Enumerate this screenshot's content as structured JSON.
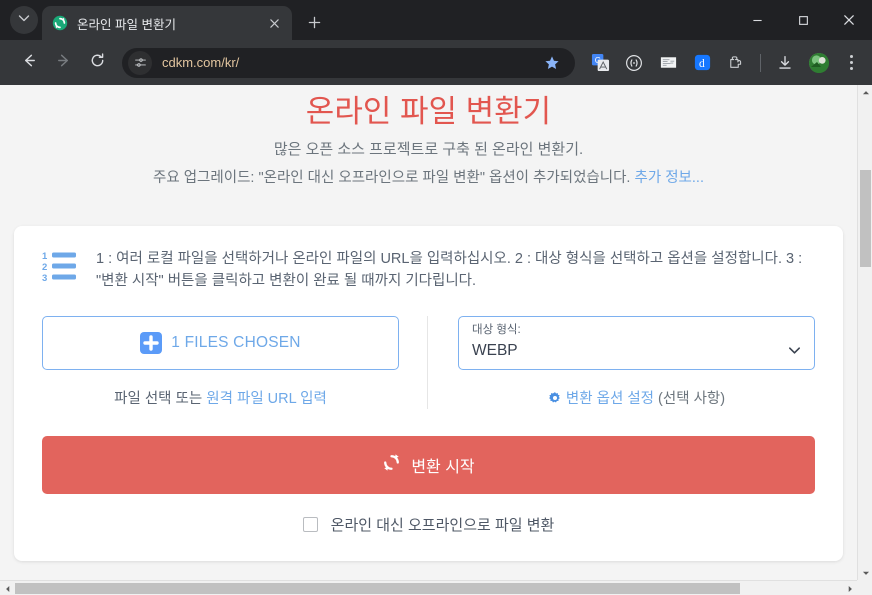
{
  "browser": {
    "tab": {
      "title": "온라인 파일 변환기",
      "favicon_name": "sync-green-favicon",
      "close_label": "✕",
      "new_tab_label": "+"
    },
    "tab_list_icon": "chevron-down-icon",
    "nav": {
      "back": "back-arrow-icon",
      "forward": "forward-arrow-icon",
      "reload": "reload-icon"
    },
    "omnibox": {
      "site_settings_icon": "tune-sliders-icon",
      "url": "cdkm.com/kr/",
      "bookmark_icon": "star-filled-icon"
    },
    "extensions": [
      {
        "name": "google-translate-icon",
        "label": "G"
      },
      {
        "name": "bracket-circle-icon",
        "label": "()"
      },
      {
        "name": "reading-list-icon",
        "label": ""
      },
      {
        "name": "d-extension-icon",
        "label": "d"
      },
      {
        "name": "puzzle-extensions-icon",
        "label": ""
      }
    ],
    "download_icon": "download-icon",
    "avatar_name": "profile-avatar",
    "menu_icon": "three-dot-menu-icon",
    "window_controls": {
      "minimize": "minimize-icon",
      "maximize": "maximize-icon",
      "close": "close-icon"
    }
  },
  "page": {
    "title": "온라인 파일 변환기",
    "subtitle": "많은 오픈 소스 프로젝트로 구축 된 온라인 변환기.",
    "notice_text": "주요 업그레이드: \"온라인 대신 오프라인으로 파일 변환\" 옵션이 추가되었습니다. ",
    "notice_link": "추가 정보...",
    "howto_icon": "numbered-list-icon",
    "howto": "1 : 여러 로컬 파일을 선택하거나 온라인 파일의 URL을 입력하십시오. 2 : 대상 형식을 선택하고 옵션을 설정합니다. 3 : \"변환 시작\" 버튼을 클릭하고 변환이 완료 될 때까지 기다립니다.",
    "file_chooser": {
      "plus_icon": "plus-square-icon",
      "label": "1 FILES CHOSEN",
      "hint_prefix": "파일 선택 또는 ",
      "hint_link": "원격 파일 URL 입력"
    },
    "target_format": {
      "label": "대상 형식:",
      "value": "WEBP",
      "caret_icon": "chevron-down-icon"
    },
    "options": {
      "gear_icon": "gear-icon",
      "link": "변환 옵션 설정",
      "suffix": " (선택 사항)"
    },
    "convert_button": {
      "icon": "refresh-sync-icon",
      "label": "변환 시작"
    },
    "offline_checkbox": {
      "label": "온라인 대신 오프라인으로 파일 변환",
      "checked": false
    }
  },
  "scrollbars": {
    "vertical_up_icon": "scroll-up-arrow-icon",
    "vertical_down_icon": "scroll-down-arrow-icon",
    "horizontal_left_icon": "scroll-left-arrow-icon",
    "horizontal_right_icon": "scroll-right-arrow-icon"
  },
  "colors": {
    "accent_red": "#e2564f",
    "button_red": "#e2645d",
    "link_blue": "#6ea8e8",
    "chrome_dark": "#202124"
  }
}
